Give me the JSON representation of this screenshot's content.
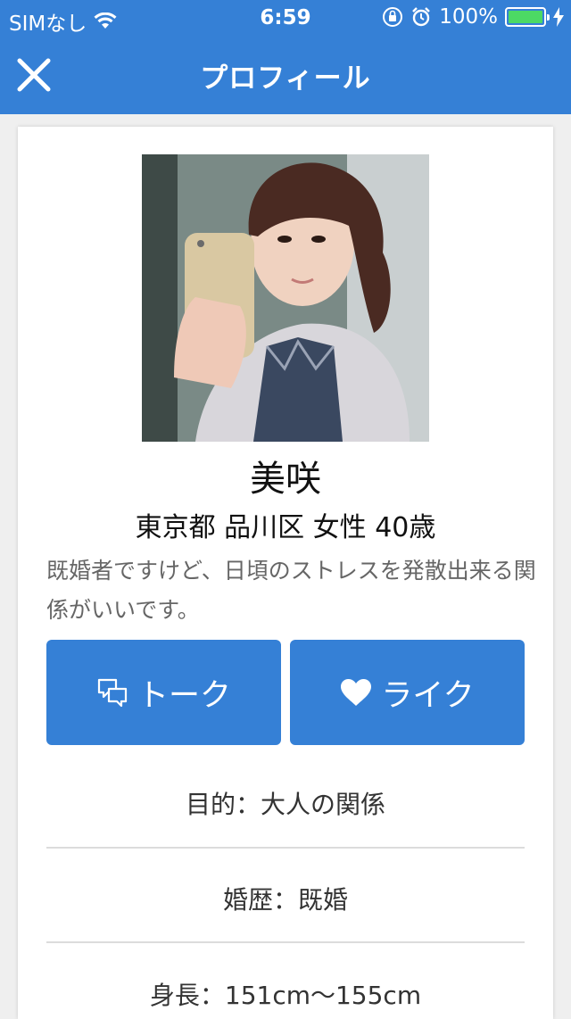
{
  "status_bar": {
    "carrier": "SIMなし",
    "time": "6:59",
    "battery": "100%"
  },
  "nav": {
    "title": "プロフィール"
  },
  "profile": {
    "name": "美咲",
    "meta": "東京都 品川区 女性 40歳",
    "bio": "既婚者ですけど、日頃のストレスを発散出来る関係がいいです。"
  },
  "actions": {
    "talk_label": "トーク",
    "like_label": "ライク"
  },
  "details": [
    {
      "text": "目的：大人の関係"
    },
    {
      "text": "婚歴：既婚"
    },
    {
      "text": "身長：151cm〜155cm"
    }
  ],
  "colors": {
    "accent": "#3580d6",
    "battery": "#4cd964"
  }
}
